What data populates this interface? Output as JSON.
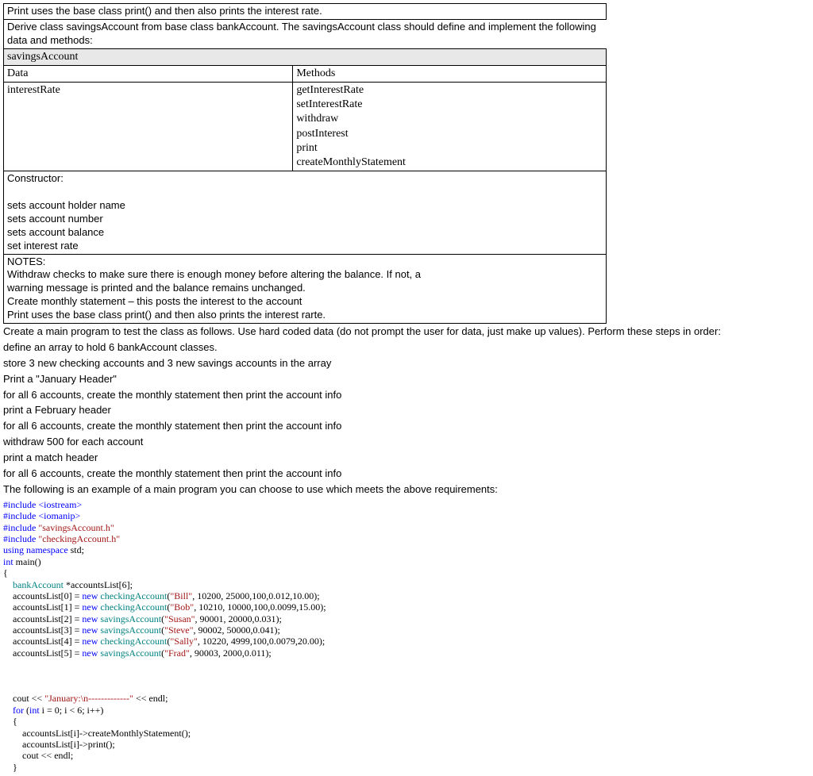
{
  "row1": "Print uses the base class print() and then also prints the interest rate.",
  "row2": "Derive class savingsAccount from base class bankAccount.    The savingsAccount class should define and implement the following data and methods:",
  "row3": "savingsAccount",
  "dataHeader": "Data",
  "methodsHeader": "Methods",
  "dataCell": "interestRate",
  "methods": [
    "getInterestRate",
    "setInterestRate",
    "withdraw",
    "postInterest",
    "print",
    "createMonthlyStatement"
  ],
  "constructorHeader": "Constructor:",
  "constructorLines": [
    "sets account holder name",
    "sets account number",
    "sets account balance",
    "set interest rate"
  ],
  "notes": "NOTES:\nWithdraw checks to make sure there is enough money before altering the balance.    If not, a\nwarning message is printed and the balance remains unchanged.\nCreate monthly statement – this posts the interest to the account\nPrint uses the base class print() and then also prints the interest rarte.",
  "mainIntro": "Create a main program to test the class as follows. Use hard coded data (do not prompt the user for data, just make up values).   Perform these steps in order:",
  "mainSteps": [
    "define an array to hold 6 bankAccount classes.",
    "store 3 new checking accounts and 3 new savings accounts in the array",
    "Print a \"January Header\"",
    "for all 6 accounts, create the monthly statement then print the account info",
    "print a February header",
    "for all 6 accounts, create the monthly statement then print the account info",
    "withdraw 500 for each account",
    "print a match header",
    "for all 6 accounts, create the monthly statement then print the account info",
    "The following is an example of a main program you can choose to use which meets the above requirements:"
  ],
  "code": {
    "includes": [
      {
        "pre": "#include ",
        "lt": "<",
        "mid": "iostream",
        "gt": ">"
      },
      {
        "pre": "#include ",
        "lt": "<",
        "mid": "iomanip",
        "gt": ">"
      },
      {
        "pre": "#include ",
        "q": "\"savingsAccount.h\""
      },
      {
        "pre": "#include ",
        "q": "\"checkingAccount.h\""
      }
    ],
    "using": "using namespace ",
    "std": "std",
    "intkw": "int ",
    "mainfn": "main()",
    "body": {
      "bank": "    bankAccount ",
      "arr": "*accountsList[6];",
      "lines": [
        {
          "lhs": "    accountsList[0] = ",
          "new": "new ",
          "cls": "checkingAccount",
          "open": "(",
          "str": "\"Bill\"",
          "rest": ", 10200, 25000,100,0.012,10.00);"
        },
        {
          "lhs": "    accountsList[1] = ",
          "new": "new ",
          "cls": "checkingAccount",
          "open": "(",
          "str": "\"Bob\"",
          "rest": ", 10210, 10000,100,0.0099,15.00);"
        },
        {
          "lhs": "    accountsList[2] = ",
          "new": "new ",
          "cls": "savingsAccount",
          "open": "(",
          "str": "\"Susan\"",
          "rest": ", 90001, 20000,0.031);"
        },
        {
          "lhs": "    accountsList[3] = ",
          "new": "new ",
          "cls": "savingsAccount",
          "open": "(",
          "str": "\"Steve\"",
          "rest": ", 90002, 50000,0.041);"
        },
        {
          "lhs": "    accountsList[4] = ",
          "new": "new ",
          "cls": "checkingAccount",
          "open": "(",
          "str": "\"Sally\"",
          "rest": ", 10220, 4999,100,0.0079,20.00);"
        },
        {
          "lhs": "    accountsList[5] = ",
          "new": "new ",
          "cls": "savingsAccount",
          "open": "(",
          "str": "\"Frad\"",
          "rest": ", 90003, 2000,0.011);"
        }
      ],
      "cout": "    cout << ",
      "janstr": "\"January:\\n-------------\"",
      "endcout": " << endl;",
      "forhead": "    for ",
      "forparen": "(",
      "forint": "int ",
      "forrest": "i = 0; i < 6; i++)",
      "loop1": "        accountsList[i]->createMonthlyStatement();",
      "loop2": "        accountsList[i]->print();",
      "loop3": "        cout << endl;"
    }
  }
}
